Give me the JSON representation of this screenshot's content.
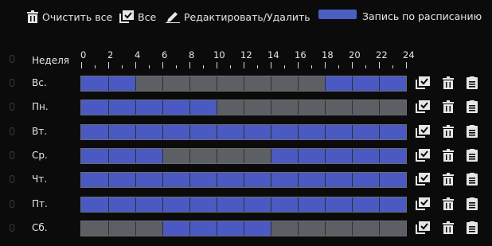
{
  "toolbar": {
    "clear_all_label": "Очистить все",
    "select_all_label": "Все",
    "edit_delete_label": "Редактировать/Удалить",
    "legend_label": "Запись по расписанию"
  },
  "colors": {
    "background": "#0b0b0b",
    "scheduled": "#4b59c2",
    "unscheduled": "#5c5f63",
    "text": "#e6e6e6"
  },
  "timeline": {
    "week_label": "Неделя",
    "hour_labels": [
      "0",
      "2",
      "4",
      "6",
      "8",
      "10",
      "12",
      "14",
      "16",
      "18",
      "20",
      "22",
      "24"
    ]
  },
  "days": [
    {
      "label": "Вс.",
      "segments": [
        [
          0,
          4
        ],
        [
          18,
          24
        ]
      ]
    },
    {
      "label": "Пн.",
      "segments": [
        [
          0,
          10
        ]
      ]
    },
    {
      "label": "Вт.",
      "segments": [
        [
          0,
          24
        ]
      ]
    },
    {
      "label": "Ср.",
      "segments": [
        [
          0,
          6
        ],
        [
          14,
          24
        ]
      ]
    },
    {
      "label": "Чт.",
      "segments": [
        [
          0,
          24
        ]
      ]
    },
    {
      "label": "Пт.",
      "segments": [
        [
          0,
          24
        ]
      ]
    },
    {
      "label": "Сб.",
      "segments": [
        [
          6,
          14
        ]
      ]
    }
  ],
  "row_icons": [
    "copy-check-icon",
    "trash-icon",
    "paste-icon"
  ]
}
